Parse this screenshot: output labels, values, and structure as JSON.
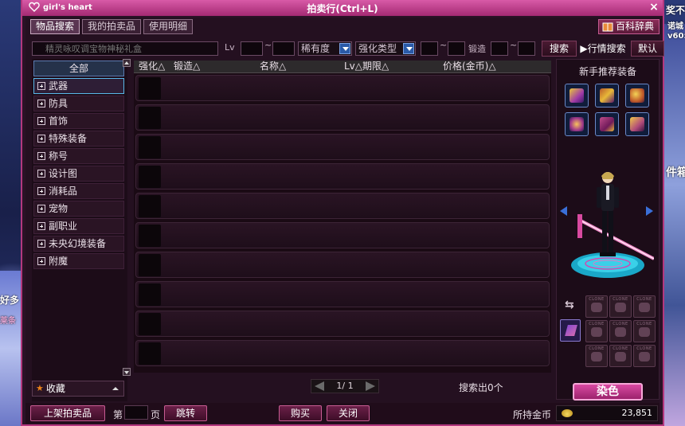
{
  "window": {
    "logo_text": "girl's heart",
    "title": "拍卖行(Ctrl+L)"
  },
  "tabs": [
    {
      "label": "物品搜索"
    },
    {
      "label": "我的拍卖品"
    },
    {
      "label": "使用明细"
    }
  ],
  "encyclopedia_label": "百科辞典",
  "search": {
    "placeholder": "精灵咏叹调宝物神秘礼盒",
    "lv_label": "Lv",
    "tilde": "~",
    "rarity_select": "稀有度",
    "enhance_select": "强化类型",
    "forge_label": "锻造",
    "search_button": "搜索",
    "market_button": "▶行情搜索",
    "default_button": "默认"
  },
  "categories": [
    {
      "label": "全部"
    },
    {
      "label": "武器"
    },
    {
      "label": "防具"
    },
    {
      "label": "首饰"
    },
    {
      "label": "特殊装备"
    },
    {
      "label": "称号"
    },
    {
      "label": "设计图"
    },
    {
      "label": "消耗品"
    },
    {
      "label": "宠物"
    },
    {
      "label": "副职业"
    },
    {
      "label": "未央幻境装备"
    },
    {
      "label": "附魔"
    }
  ],
  "favorites_label": "收藏",
  "table_headers": [
    "强化△",
    "锻造△",
    "名称△",
    "Lv△期限△",
    "价格(金币)△"
  ],
  "pager": {
    "text": "1/ 1"
  },
  "search_result": "搜索出0个",
  "right": {
    "rec_title": "新手推荐装备",
    "clone_tag": "CLONE",
    "dye_button": "染色"
  },
  "bottom": {
    "list_button": "上架拍卖品",
    "page_prefix": "第",
    "page_suffix": "页",
    "jump_button": "跳转",
    "buy_button": "购买",
    "close_button": "关闭",
    "gold_label": "所持金币",
    "gold_value": "23,851"
  },
  "background_texts": [
    "奖不",
    "诺城",
    "v60:",
    "件箱",
    "好多",
    "莱条"
  ]
}
